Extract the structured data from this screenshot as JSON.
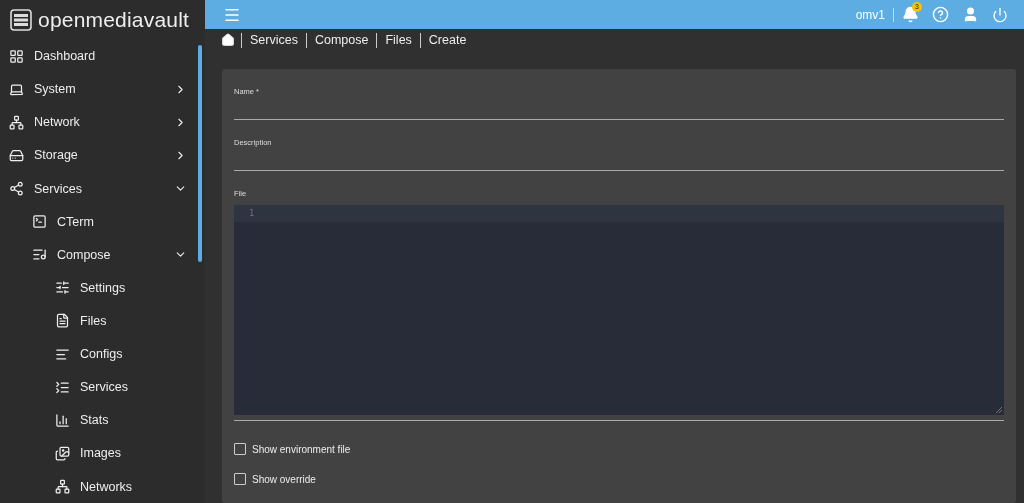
{
  "logo": {
    "text": "openmediavault"
  },
  "sidebar": {
    "items": [
      {
        "label": "Dashboard"
      },
      {
        "label": "System",
        "expanded": false
      },
      {
        "label": "Network",
        "expanded": false
      },
      {
        "label": "Storage",
        "expanded": false
      },
      {
        "label": "Services",
        "expanded": true,
        "children": [
          {
            "label": "CTerm"
          },
          {
            "label": "Compose",
            "expanded": true,
            "children": [
              {
                "label": "Settings"
              },
              {
                "label": "Files"
              },
              {
                "label": "Configs"
              },
              {
                "label": "Services"
              },
              {
                "label": "Stats"
              },
              {
                "label": "Images"
              },
              {
                "label": "Networks"
              }
            ]
          }
        ]
      }
    ]
  },
  "topbar": {
    "hostname": "omv1",
    "notification_count": "3"
  },
  "breadcrumb": [
    "Services",
    "Compose",
    "Files",
    "Create"
  ],
  "form": {
    "fields": [
      {
        "label": "Name *"
      },
      {
        "label": "Description"
      }
    ],
    "file_editor": {
      "label": "File",
      "line_numbers": [
        "1"
      ]
    },
    "checkboxes": [
      {
        "label": "Show environment file",
        "checked": false
      },
      {
        "label": "Show override",
        "checked": false
      }
    ]
  }
}
